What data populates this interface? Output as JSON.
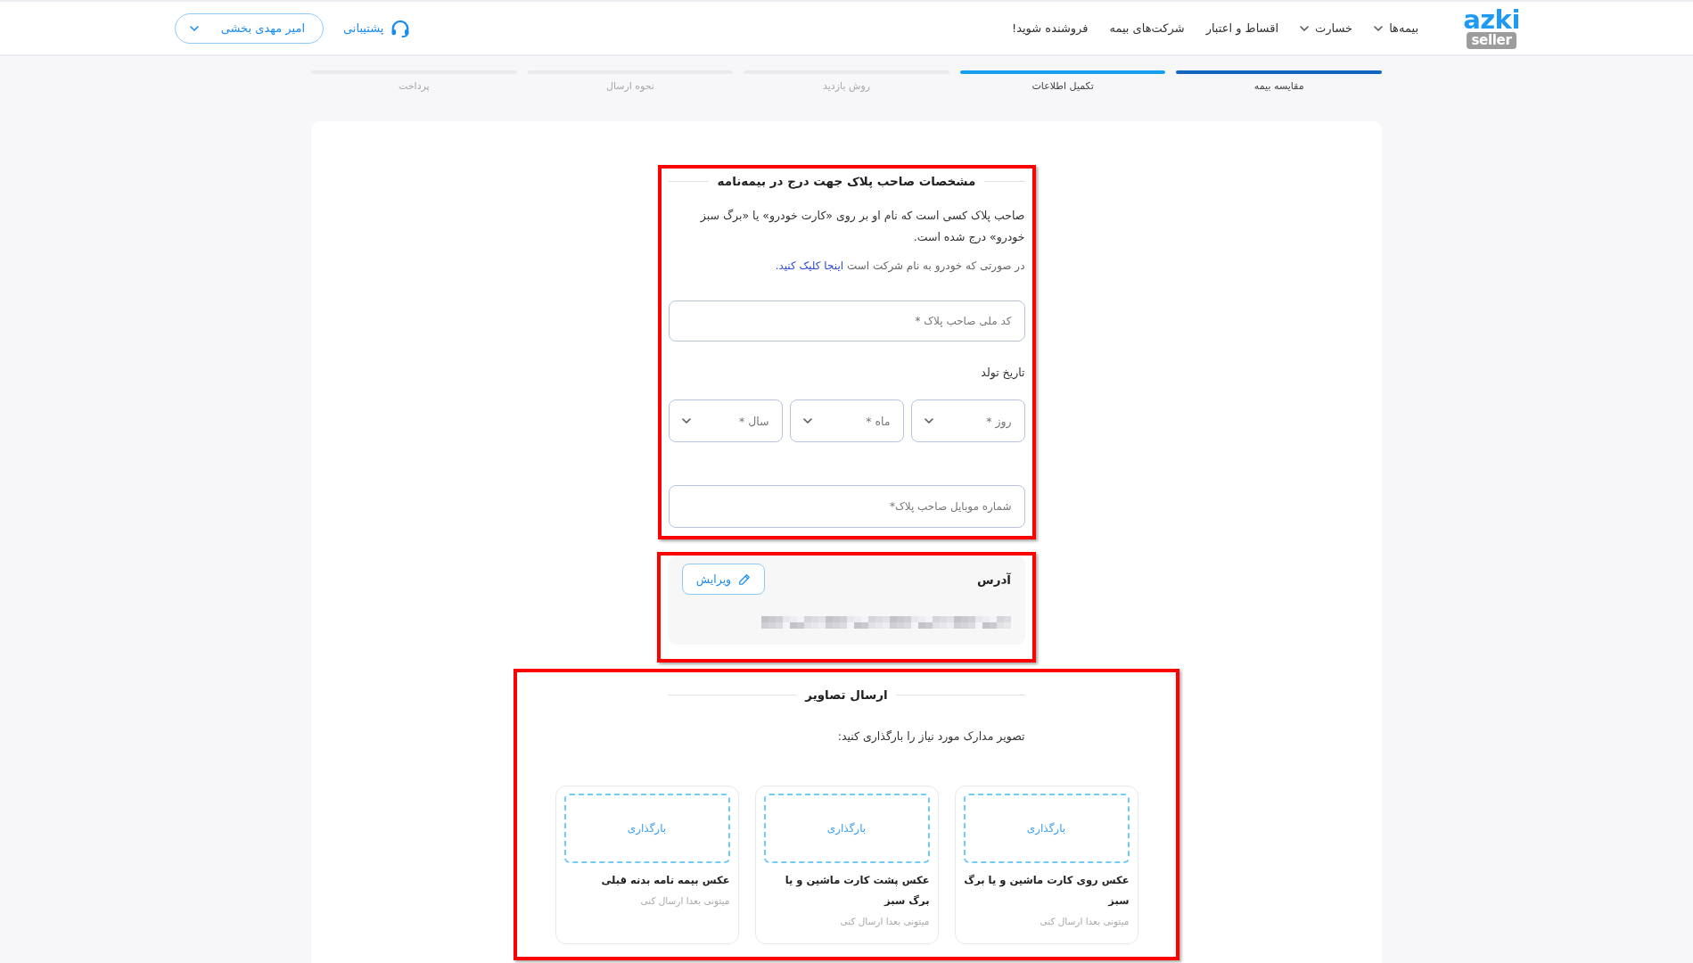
{
  "header": {
    "logo": {
      "word": "azki",
      "badge": "seller"
    },
    "nav": [
      {
        "label": "بیمه‌ها",
        "dropdown": true
      },
      {
        "label": "خسارت",
        "dropdown": true
      },
      {
        "label": "اقساط و اعتبار",
        "dropdown": false
      },
      {
        "label": "شرکت‌های بیمه",
        "dropdown": false
      },
      {
        "label": "فروشنده شوید!",
        "dropdown": false
      }
    ],
    "support": "پشتیبانی",
    "user_menu": "امیر مهدی بخشی"
  },
  "steps": [
    {
      "label": "مقایسه بیمه",
      "done": true,
      "active": false
    },
    {
      "label": "تکمیل اطلاعات",
      "done": false,
      "active": true
    },
    {
      "label": "روش بازدید",
      "done": false,
      "active": false
    },
    {
      "label": "نحوه ارسال",
      "done": false,
      "active": false
    },
    {
      "label": "پرداخت",
      "done": false,
      "active": false
    }
  ],
  "owner_section": {
    "highlighted": true,
    "title": "مشخصات صاحب پلاک جهت درج در بیمه‌نامه",
    "description": "صاحب پلاک کسی است که نام او بر روی «کارت خودرو» یا «برگ سبز خودرو» درج شده است.",
    "company_note": {
      "text": "در صورتی که خودرو به نام شرکت است",
      "link": "اینجا کلیک کنید."
    },
    "national_id": {
      "placeholder": "کد ملی صاحب پلاک *"
    },
    "birth_date": {
      "label": "تاریخ تولد",
      "selects": [
        {
          "placeholder": "روز *"
        },
        {
          "placeholder": "ماه *"
        },
        {
          "placeholder": "سال *"
        }
      ]
    },
    "mobile": {
      "placeholder": "شماره موبایل صاحب پلاک*"
    }
  },
  "address_section": {
    "highlighted": true,
    "title": "آدرس",
    "edit_button": "ویرایش"
  },
  "upload_section": {
    "highlighted": true,
    "title": "ارسال تصاویر",
    "prompt": "تصویر مدارک مورد نیاز را بارگذاری کنید:",
    "items": [
      {
        "upload_label": "بارگذاری",
        "title": "عکس روی کارت ماشین و یا برگ سبز",
        "note": "میتونی بعدا ارسال کنی"
      },
      {
        "upload_label": "بارگذاری",
        "title": "عکس پشت کارت ماشین و یا برگ سبز",
        "note": "میتونی بعدا ارسال کنی"
      },
      {
        "upload_label": "بارگذاری",
        "title": "عکس بیمه نامه بدنه قبلی",
        "note": "میتونی بعدا ارسال کنی"
      }
    ]
  }
}
